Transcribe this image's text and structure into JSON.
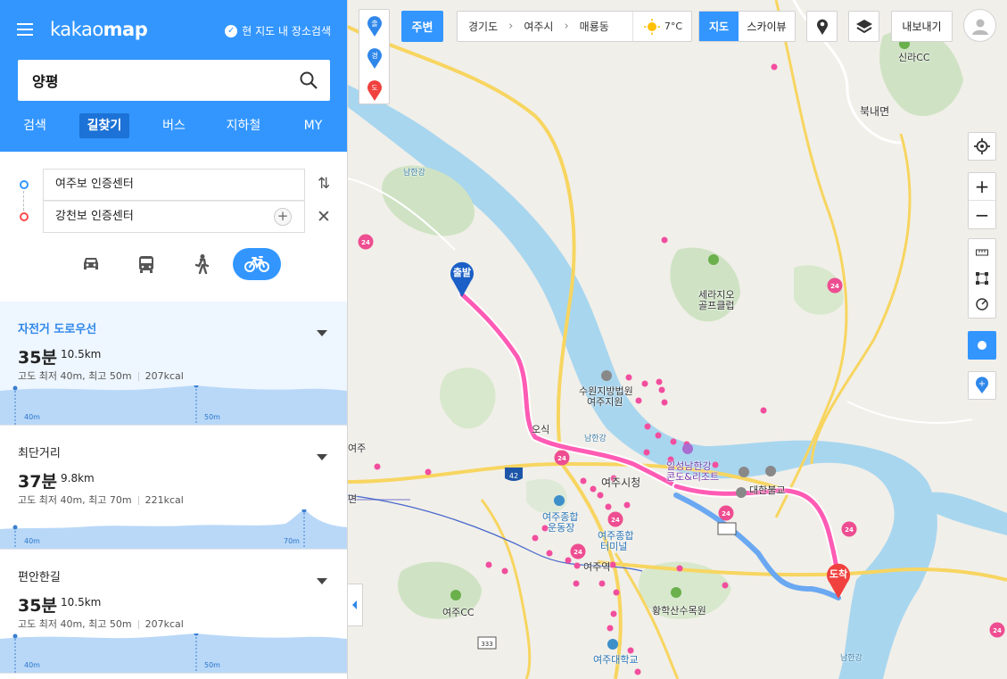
{
  "sidebar": {
    "logo_light": "kakao",
    "logo_bold": "map",
    "current_area_search": "현 지도 내 장소검색",
    "search_value": "양평",
    "tabs": [
      "검색",
      "길찾기",
      "버스",
      "지하철",
      "MY"
    ],
    "active_tab": "길찾기",
    "origin": "여주보 인증센터",
    "destination": "강천보 인증센터",
    "modes": [
      "car-icon",
      "bus-icon",
      "walk-icon",
      "bicycle-icon"
    ],
    "active_mode": "bicycle-icon"
  },
  "results": [
    {
      "name": "자전거 도로우선",
      "time": "35분",
      "distance": "10.5km",
      "elevation": "고도 최저 40m, 최고 50m",
      "calories": "207kcal",
      "low_label": "40m",
      "high_label": "50m",
      "selected": true
    },
    {
      "name": "최단거리",
      "time": "37분",
      "distance": "9.8km",
      "elevation": "고도 최저 40m, 최고 70m",
      "calories": "221kcal",
      "low_label": "40m",
      "high_label": "70m",
      "selected": false
    },
    {
      "name": "편안한길",
      "time": "35분",
      "distance": "10.5km",
      "elevation": "고도 최저 40m, 최고 50m",
      "calories": "207kcal",
      "low_label": "40m",
      "high_label": "50m",
      "selected": false
    }
  ],
  "map": {
    "route_type_pins": [
      "출",
      "경",
      "도"
    ],
    "nearby_label": "주변",
    "breadcrumb": [
      "경기도",
      "여주시",
      "매룡동"
    ],
    "temperature": "7°C",
    "map_types": [
      "지도",
      "스카이뷰"
    ],
    "active_map_type": "지도",
    "export_label": "내보내기",
    "start_marker": "출발",
    "end_marker": "도착",
    "labels": {
      "shilla_cc": "신라CC",
      "bungnae": "북내면",
      "namhangang_1": "남한강",
      "namhangang_2": "남한강",
      "namhangang_3": "남한강",
      "serajio_1": "세라지오",
      "serajio_2": "골프클럽",
      "court_1": "수원지방법원",
      "court_2": "여주지원",
      "oseok": "여주",
      "yeoju_hq": "여주시청",
      "ilseong_1": "일성남한강",
      "ilseong_2": "콘도&리조트",
      "daehan": "대한불교",
      "myeon": "면",
      "stadium_1": "여주종합",
      "stadium_2": "운동장",
      "terminal_1": "여주종합",
      "terminal_2": "터미널",
      "yeoju_station": "여주역",
      "yeoju_cc": "여주CC",
      "arboretum": "황학산수목원",
      "university": "여주대학교",
      "road_42": "42",
      "road_333": "333",
      "road_24": "24",
      "osik": "오식"
    }
  }
}
